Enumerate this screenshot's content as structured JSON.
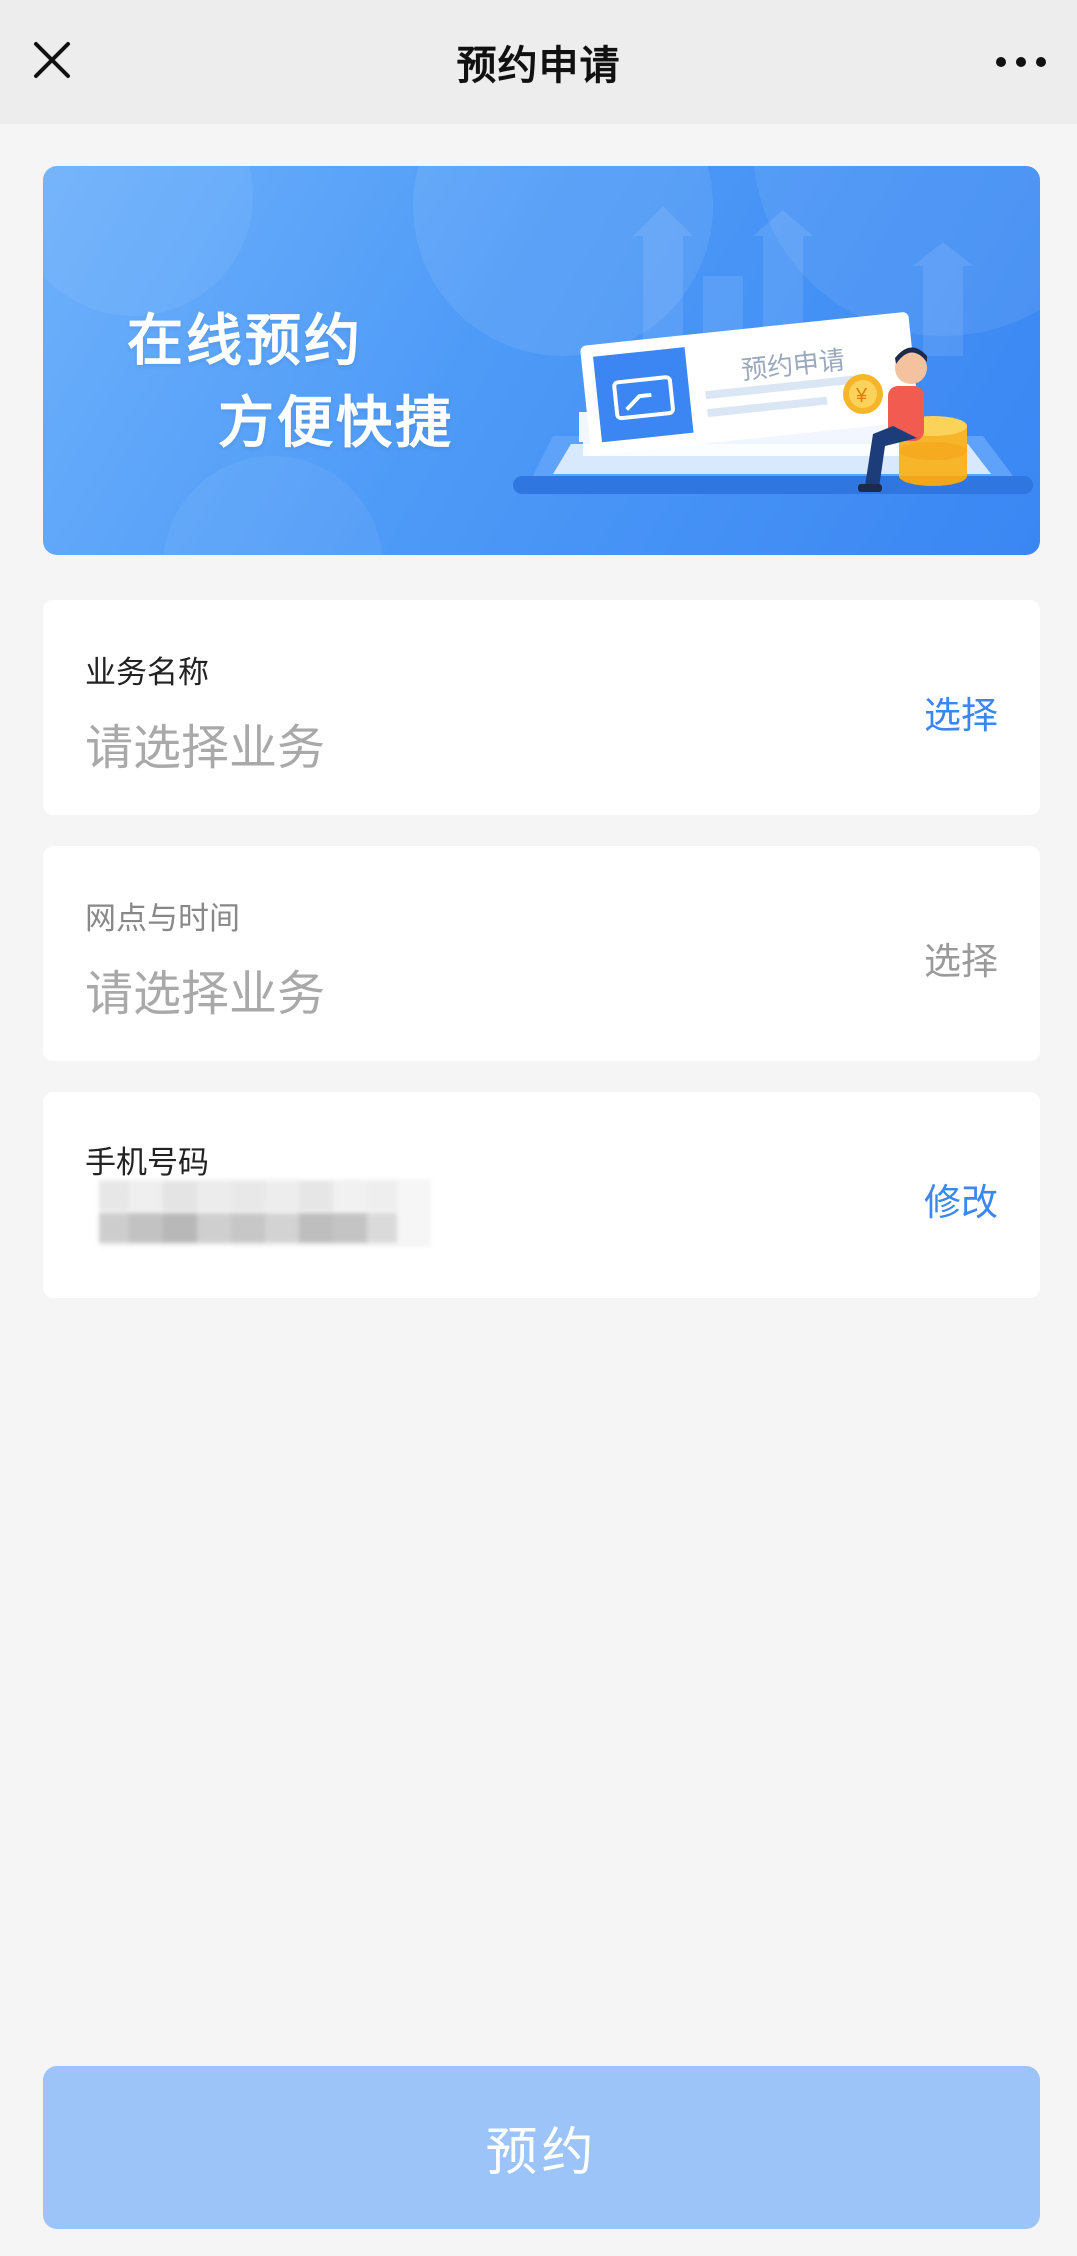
{
  "navbar": {
    "title": "预约申请",
    "close_icon": "close-icon",
    "more_icon": "more-dots-icon"
  },
  "banner": {
    "line1": "在线预约",
    "line2": "方便快捷",
    "card_text": "预约申请",
    "coin_symbol": "¥",
    "colors": {
      "gradient_start": "#6eb1fb",
      "gradient_end": "#3a86f3"
    }
  },
  "form": {
    "business": {
      "label": "业务名称",
      "placeholder": "请选择业务",
      "action": "选择"
    },
    "outlet_time": {
      "label": "网点与时间",
      "placeholder": "请选择业务",
      "action": "选择"
    },
    "phone": {
      "label": "手机号码",
      "action": "修改"
    }
  },
  "submit": {
    "label": "预约"
  },
  "colors": {
    "accent": "#3b86f2",
    "background": "#f5f5f5",
    "button_disabled": "#9cc4f8"
  }
}
